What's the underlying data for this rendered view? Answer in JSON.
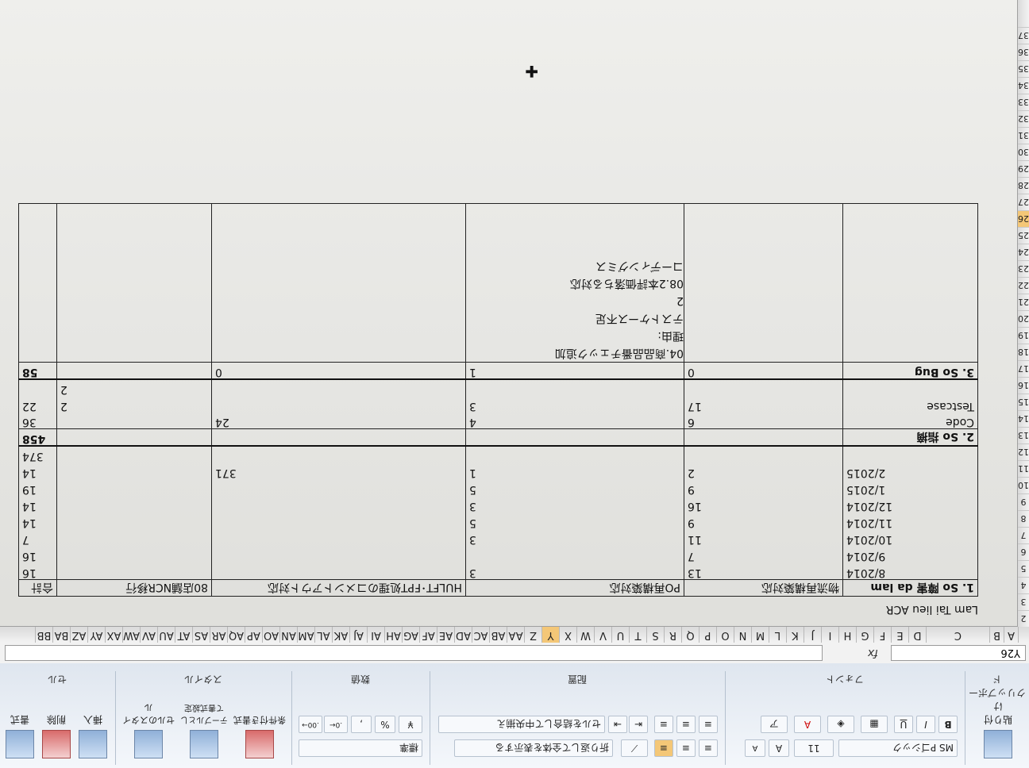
{
  "ribbon": {
    "font_name": "MS Pゴシック",
    "font_size": "11",
    "wrap_text": "折り返して全体を表示する",
    "merge_center": "セルを結合して中央揃え",
    "number_format": "標準",
    "groups": [
      "クリップボード",
      "フォント",
      "配置",
      "数値",
      "スタイル",
      "セル"
    ],
    "styles": {
      "conditional": "条件付き書式",
      "table": "テーブルとして書式設定",
      "cell": "セルのスタイル"
    },
    "cells": {
      "insert": "挿入",
      "delete": "削除",
      "format": "書式"
    },
    "paste": "貼り付け"
  },
  "formula_bar": {
    "name_box": "Y26",
    "fx": "fx",
    "value": ""
  },
  "columns": [
    "A",
    "B",
    "C",
    "D",
    "E",
    "F",
    "G",
    "H",
    "I",
    "J",
    "K",
    "L",
    "M",
    "N",
    "O",
    "P",
    "Q",
    "R",
    "S",
    "T",
    "U",
    "V",
    "W",
    "X",
    "Y",
    "Z",
    "AA",
    "AB",
    "AC",
    "AD",
    "AE",
    "AF",
    "AG",
    "AH",
    "AI",
    "AJ",
    "AK",
    "AL",
    "AM",
    "AN",
    "AO",
    "AP",
    "AQ",
    "AR",
    "AS",
    "AT",
    "AU",
    "AV",
    "AW",
    "AX",
    "AY",
    "AZ",
    "BA",
    "BB"
  ],
  "selected_column": "Y",
  "rows": [
    "2",
    "3",
    "4",
    "5",
    "6",
    "7",
    "8",
    "9",
    "10",
    "11",
    "12",
    "13",
    "14",
    "15",
    "16",
    "17",
    "18",
    "19",
    "20",
    "21",
    "22",
    "23",
    "24",
    "25",
    "26",
    "27",
    "28",
    "29",
    "30",
    "31",
    "32",
    "33",
    "34",
    "35",
    "36",
    "37"
  ],
  "selected_row": "26",
  "sheet": {
    "title": "Lam Tai lieu ACR",
    "headers": [
      "1. So  障害  da lam",
      "物流再構築対応",
      "PO再構築対応",
      "HULFT･FPT処理のコメントアウト対応",
      "80店舗NCR移行",
      "合計"
    ],
    "months": [
      {
        "label": "8/2014",
        "vals": [
          "13",
          "3",
          "",
          "",
          "",
          "16"
        ]
      },
      {
        "label": "9/2014",
        "vals": [
          "7",
          "",
          "",
          "",
          "",
          "16"
        ]
      },
      {
        "label": "10/2014",
        "vals": [
          "11",
          "3",
          "",
          "",
          "",
          "7"
        ]
      },
      {
        "label": "11/2014",
        "vals": [
          "9",
          "5",
          "",
          "",
          "",
          "14"
        ]
      },
      {
        "label": "12/2014",
        "vals": [
          "16",
          "3",
          "",
          "",
          "",
          "14"
        ]
      },
      {
        "label": "1/2015",
        "vals": [
          "9",
          "5",
          "",
          "",
          "",
          "19"
        ]
      },
      {
        "label": "2/2015",
        "vals": [
          "2",
          "1",
          "371",
          "",
          "",
          "14"
        ]
      },
      {
        "label": "",
        "vals": [
          "",
          "",
          "",
          "",
          "",
          "374"
        ]
      }
    ],
    "section2": {
      "label": "2. So  指摘",
      "total": "458"
    },
    "code": {
      "label": "Code",
      "vals": [
        "6",
        "4",
        "24",
        "",
        "",
        "36"
      ]
    },
    "testcase": {
      "label": "Testcase",
      "vals": [
        "17",
        "3",
        "",
        "2",
        "",
        "22"
      ]
    },
    "bug": {
      "label": "3. So Bug",
      "vals": [
        "0",
        "1",
        "0",
        "",
        "",
        "58"
      ]
    },
    "bug_extra_2": "2",
    "reason_lines": [
      "04.商品品番チェック追加",
      "理由:",
      "テストケース不足",
      "2",
      "08.2本評価落ちる対応",
      "コーディングミス"
    ]
  }
}
